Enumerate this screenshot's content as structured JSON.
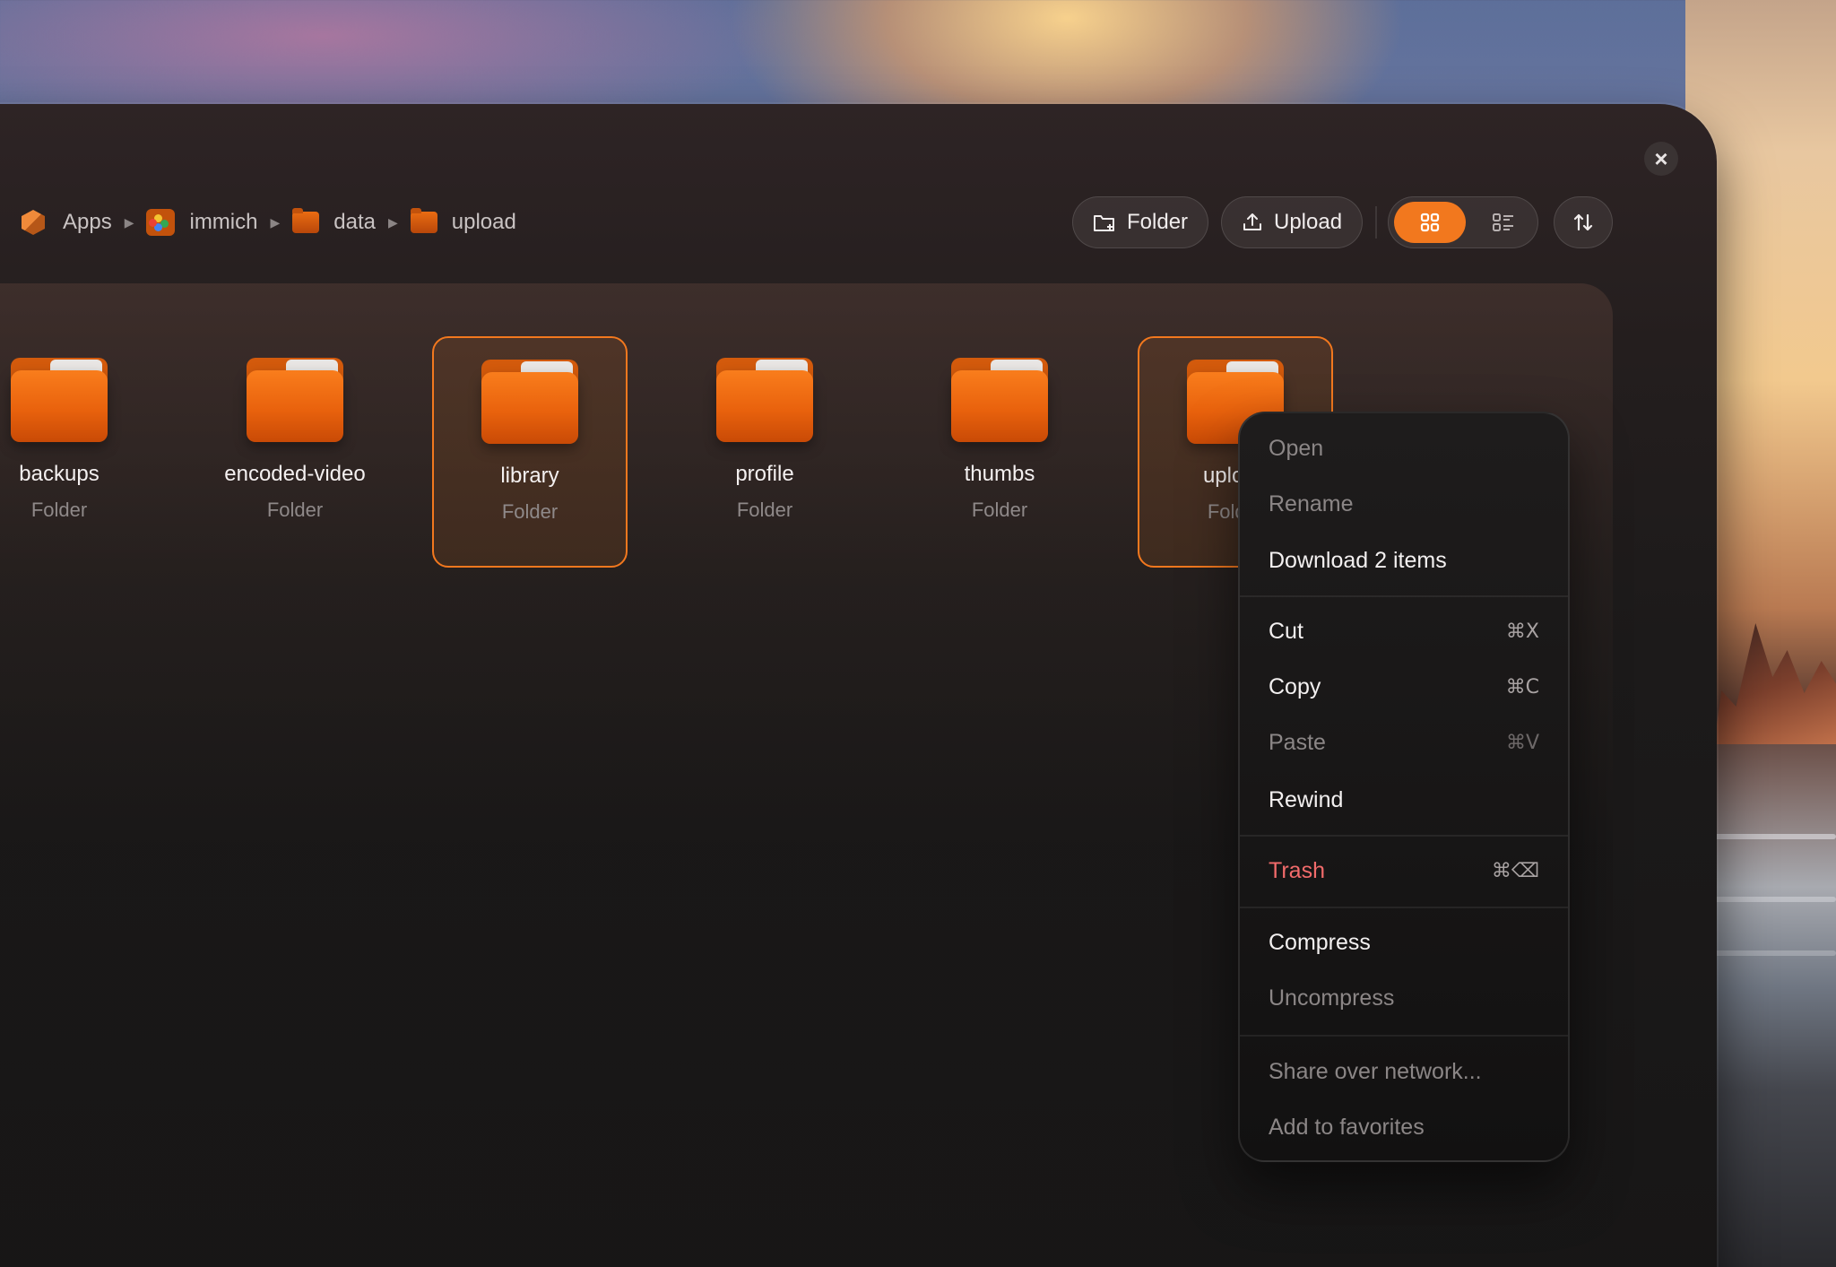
{
  "breadcrumb": [
    {
      "label": "Apps",
      "icon": "box-icon"
    },
    {
      "label": "immich",
      "icon": "photos-app-icon"
    },
    {
      "label": "data",
      "icon": "folder-icon"
    },
    {
      "label": "upload",
      "icon": "folder-icon"
    }
  ],
  "toolbar": {
    "new_folder_label": "Folder",
    "upload_label": "Upload",
    "view_mode": "grid",
    "accent_color": "#f2781e"
  },
  "folders": [
    {
      "name": "backups",
      "kind": "Folder",
      "selected": false
    },
    {
      "name": "encoded-video",
      "kind": "Folder",
      "selected": false
    },
    {
      "name": "library",
      "kind": "Folder",
      "selected": true
    },
    {
      "name": "profile",
      "kind": "Folder",
      "selected": false
    },
    {
      "name": "thumbs",
      "kind": "Folder",
      "selected": false
    },
    {
      "name": "upload",
      "kind": "Folder",
      "selected": true
    }
  ],
  "context_menu": {
    "open": "Open",
    "rename": "Rename",
    "download": "Download 2 items",
    "cut": "Cut",
    "cut_shortcut": "⌘X",
    "copy": "Copy",
    "copy_shortcut": "⌘C",
    "paste": "Paste",
    "paste_shortcut": "⌘V",
    "rewind": "Rewind",
    "trash": "Trash",
    "trash_shortcut": "⌘⌫",
    "compress": "Compress",
    "uncompress": "Uncompress",
    "share": "Share over network...",
    "favorites": "Add to favorites"
  }
}
